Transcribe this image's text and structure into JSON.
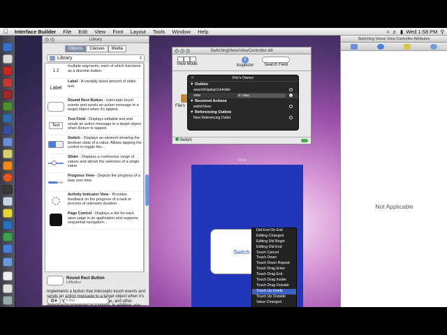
{
  "menubar": {
    "app_name": "Interface Builder",
    "menus": [
      "File",
      "Edit",
      "View",
      "Font",
      "Layout",
      "Tools",
      "Window",
      "Help"
    ],
    "clock": "Wed 1:58 PM"
  },
  "library": {
    "title": "Library",
    "tabs": [
      "Objects",
      "Classes",
      "Media"
    ],
    "selected_tab": "Objects",
    "group": "Library",
    "items": [
      {
        "icon": "1 2",
        "name": "",
        "desc": "multiple segments, each of which functions as a discrete button."
      },
      {
        "icon": "Label",
        "name": "Label",
        "desc": " - A variably sized amount of static text."
      },
      {
        "icon": "",
        "name": "Round Rect Button",
        "desc": " - Intercepts touch events and sends an action message to a target object when it's tapped."
      },
      {
        "icon": "Text",
        "name": "Text Field",
        "desc": " - Displays editable text and sends an action message to a target object when Return is tapped."
      },
      {
        "icon": "",
        "name": "Switch",
        "desc": " - Displays an element showing the boolean state of a value. Allows tapping the control to toggle the..."
      },
      {
        "icon": "",
        "name": "Slider",
        "desc": " - Displays a continuous range of values and allows the selection of a single value."
      },
      {
        "icon": "",
        "name": "Progress View",
        "desc": " - Depicts the progress of a task over time."
      },
      {
        "icon": "",
        "name": "Activity Indicator View",
        "desc": " - Provides feedback on the progress of a task or process of unknown duration."
      },
      {
        "icon": "",
        "name": "Page Control",
        "desc": " - Displays a dot for each open page in an application and supports sequential navigation..."
      }
    ],
    "detail": {
      "name": "Round Rect Button",
      "class": "UIButton",
      "text": "Implements a button that intercepts touch events and sends an action message to a target object when it's tapped. You can set the title, image, and other appearance properties of a button. In addition, you can specify a different appearance for each button state."
    },
    "filter_placeholder": "Filter"
  },
  "xib": {
    "title": "SwitchingViewsViewController.xib",
    "view_mode": "View Mode",
    "inspector": "Inspector",
    "search_field": "Search Field",
    "files_owner": "File's",
    "status": "Switch"
  },
  "hud": {
    "title": "File's Owner",
    "outlets_label": "Outlets",
    "outlets": [
      "searchDisplayController",
      "view"
    ],
    "view_connection": "View",
    "received_label": "Received Actions",
    "received": [
      "switchView:"
    ],
    "referencing_label": "Referencing Outlets",
    "referencing": [
      "New Referencing Outlet"
    ]
  },
  "canvas": {
    "view_label": "View",
    "button_text": "Switch"
  },
  "events": {
    "items": [
      "Did End On Exit",
      "Editing Changed",
      "Editing Did Begin",
      "Editing Did End",
      "Touch Cancel",
      "Touch Down",
      "Touch Down Repeat",
      "Touch Drag Enter",
      "Touch Drag Exit",
      "Touch Drag Inside",
      "Touch Drag Outside",
      "Touch Up Inside",
      "Touch Up Outside",
      "Value Changed"
    ],
    "highlighted": "Touch Up Inside"
  },
  "attributes": {
    "title": "Switching Views View Controller Attributes",
    "empty_text": "Not Applicable"
  },
  "colors": {
    "view_background": "#2136b8",
    "highlight": "#3f61c4"
  }
}
